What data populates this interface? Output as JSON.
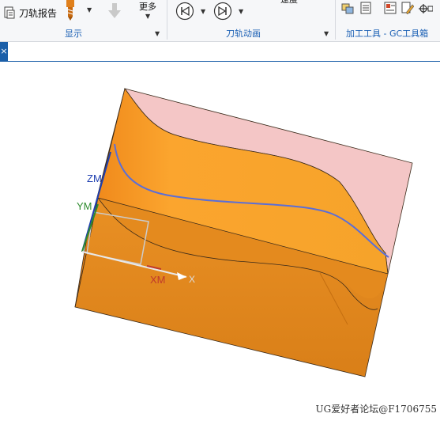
{
  "ribbon": {
    "toolpath_report": "刀轨报告",
    "more": "更多",
    "display_group": "显示",
    "animation_group": "刀轨动画",
    "tools_group": "加工工具 - GC工具箱",
    "partial_top_label": "速度"
  },
  "toolbar": {
    "close_glyph": "×"
  },
  "viewport": {
    "triad": {
      "zm": "ZM",
      "ym": "YM",
      "xm": "XM",
      "x": "X"
    },
    "colors": {
      "part_body": "#e8901e",
      "part_top": "#f5a42c",
      "stock": "#f2c4c4",
      "toolpath": "#5a6ed8"
    }
  },
  "watermark": "UG爱好者论坛@F1706755"
}
